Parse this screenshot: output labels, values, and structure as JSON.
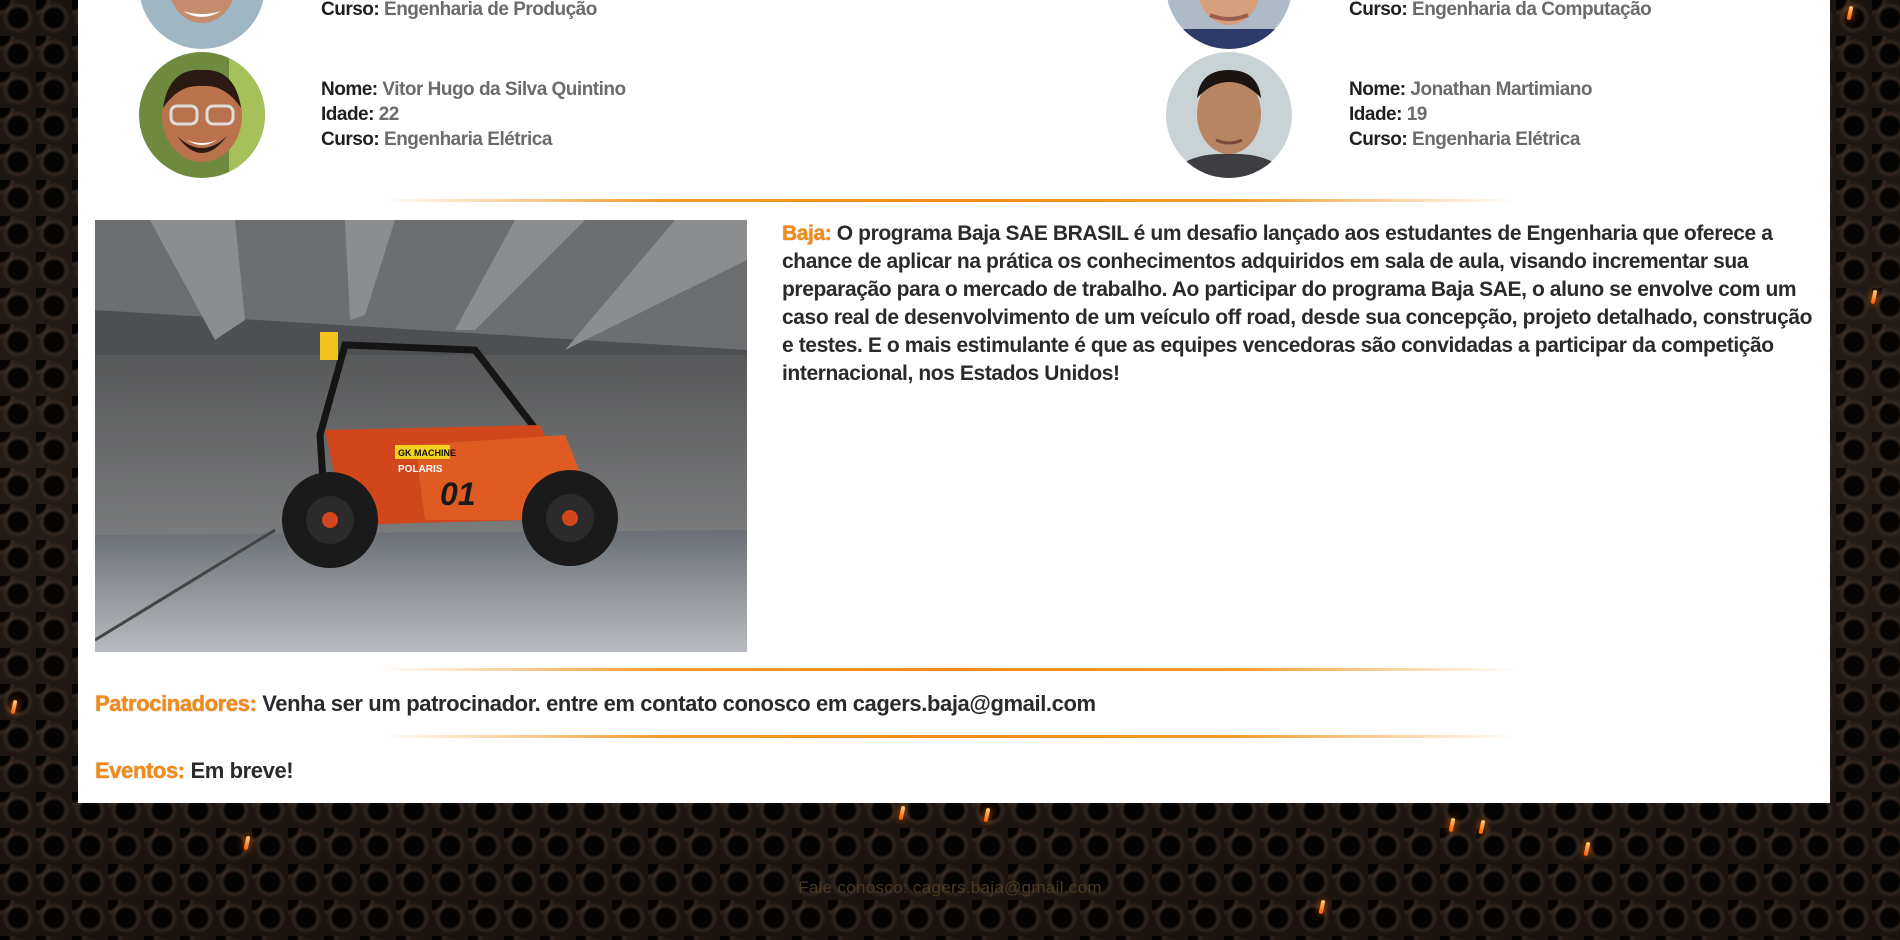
{
  "team": {
    "members": [
      {
        "curso_label": "Curso:",
        "curso": "Engenharia de Produção"
      },
      {
        "curso_label": "Curso:",
        "curso": "Engenharia da Computação"
      },
      {
        "nome_label": "Nome:",
        "nome": "Vitor Hugo da Silva Quintino",
        "idade_label": "Idade:",
        "idade": "22",
        "curso_label": "Curso:",
        "curso": "Engenharia Elétrica"
      },
      {
        "nome_label": "Nome:",
        "nome": "Jonathan Martimiano",
        "idade_label": "Idade:",
        "idade": "19",
        "curso_label": "Curso:",
        "curso": "Engenharia Elétrica"
      }
    ]
  },
  "baja": {
    "heading": "Baja:",
    "text": "O programa Baja SAE BRASIL é um desafio lançado aos estudantes de Engenharia que oferece a chance de aplicar na prática os conhecimentos adquiridos em sala de aula, visando incrementar sua preparação para o mercado de trabalho. Ao participar do programa Baja SAE, o aluno se envolve com um caso real de desenvolvimento de um veículo off road, desde sua concepção, projeto detalhado, construção e testes. E o mais estimulante é que as equipes vencedoras são convidadas a participar da competição internacional, nos Estados Unidos!",
    "car_number": "01",
    "car_decal": "GK MACHINE",
    "car_brand": "POLARIS"
  },
  "sponsors": {
    "heading": "Patrocinadores:",
    "text": "Venha ser um patrocinador. entre em contato conosco em cagers.baja@gmail.com"
  },
  "events": {
    "heading": "Eventos:",
    "text": "Em breve!"
  },
  "footer": {
    "text": "Fale conosco: cagers.baja@gmail.com"
  },
  "colors": {
    "accent": "#f08a1a",
    "card": "#ffffff",
    "background": "#1b1512"
  }
}
